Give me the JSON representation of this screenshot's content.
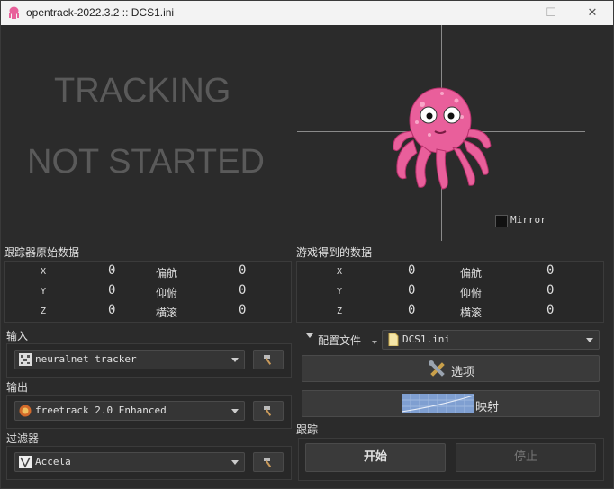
{
  "window": {
    "title": "opentrack-2022.3.2 :: DCS1.ini",
    "minimize": "—",
    "maximize": "☐",
    "close": "✕"
  },
  "status": {
    "line1": "TRACKING",
    "line2": "NOT STARTED"
  },
  "mirror": {
    "label": "Mirror"
  },
  "raw": {
    "title": "跟踪器原始数据",
    "rows": [
      {
        "axis": "X",
        "val": "0",
        "rot": "偏航",
        "rval": "0"
      },
      {
        "axis": "Y",
        "val": "0",
        "rot": "仰俯",
        "rval": "0"
      },
      {
        "axis": "Z",
        "val": "0",
        "rot": "横滚",
        "rval": "0"
      }
    ]
  },
  "game": {
    "title": "游戏得到的数据",
    "rows": [
      {
        "axis": "X",
        "val": "0",
        "rot": "偏航",
        "rval": "0"
      },
      {
        "axis": "Y",
        "val": "0",
        "rot": "仰俯",
        "rval": "0"
      },
      {
        "axis": "Z",
        "val": "0",
        "rot": "横滚",
        "rval": "0"
      }
    ]
  },
  "input": {
    "label": "输入",
    "value": "neuralnet tracker"
  },
  "output": {
    "label": "输出",
    "value": "freetrack 2.0 Enhanced"
  },
  "filter": {
    "label": "过滤器",
    "value": "Accela"
  },
  "profile": {
    "label": "配置文件",
    "value": "DCS1.ini"
  },
  "options": {
    "label": "选项"
  },
  "mapping": {
    "label": "映射"
  },
  "tracking": {
    "label": "跟踪",
    "start": "开始",
    "stop": "停止"
  }
}
